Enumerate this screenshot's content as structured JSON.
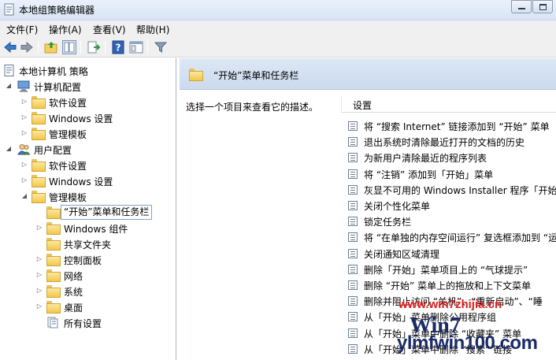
{
  "window": {
    "title": "本地组策略编辑器"
  },
  "menu": [
    "文件(F)",
    "操作(A)",
    "查看(V)",
    "帮助(H)"
  ],
  "tree": {
    "root": "本地计算机 策略",
    "computer_config": "计算机配置",
    "computer_children": [
      "软件设置",
      "Windows 设置",
      "管理模板"
    ],
    "user_config": "用户配置",
    "user_children": [
      "软件设置",
      "Windows 设置",
      "管理模板"
    ],
    "admin_templates_children": [
      "“开始”菜单和任务栏",
      "Windows 组件",
      "共享文件夹",
      "控制面板",
      "网络",
      "系统",
      "桌面",
      "所有设置"
    ],
    "selected": "“开始”菜单和任务栏"
  },
  "details": {
    "header_title": "“开始”菜单和任务栏",
    "description": "选择一个项目来查看它的描述。",
    "column_header": "设置",
    "policies": [
      "将 “搜索 Internet” 链接添加到 “开始” 菜单",
      "退出系统时清除最近打开的文档的历史",
      "为新用户清除最近的程序列表",
      "将 “注销” 添加到「开始」菜单",
      "灰显不可用的 Windows Installer 程序「开始",
      "关闭个性化菜单",
      "锁定任务栏",
      "将 “在单独的内存空间运行” 复选框添加到 “运",
      "关闭通知区域清理",
      "删除「开始」菜单项目上的 “气球提示”",
      "删除 “开始” 菜单上的拖放和上下文菜单",
      "删除并阻止访问 “关机”、“重新启动”、“睡",
      "从「开始」菜单删除公用程序组",
      "从「开始」菜单中删除 “收藏夹” 菜单",
      "从「开始」菜单中删除 “搜索” 链接"
    ]
  },
  "watermark": {
    "url_top": "www.win7zhijia.cn",
    "logo": "Win7",
    "url_bottom": "ylmfwin100.com"
  }
}
